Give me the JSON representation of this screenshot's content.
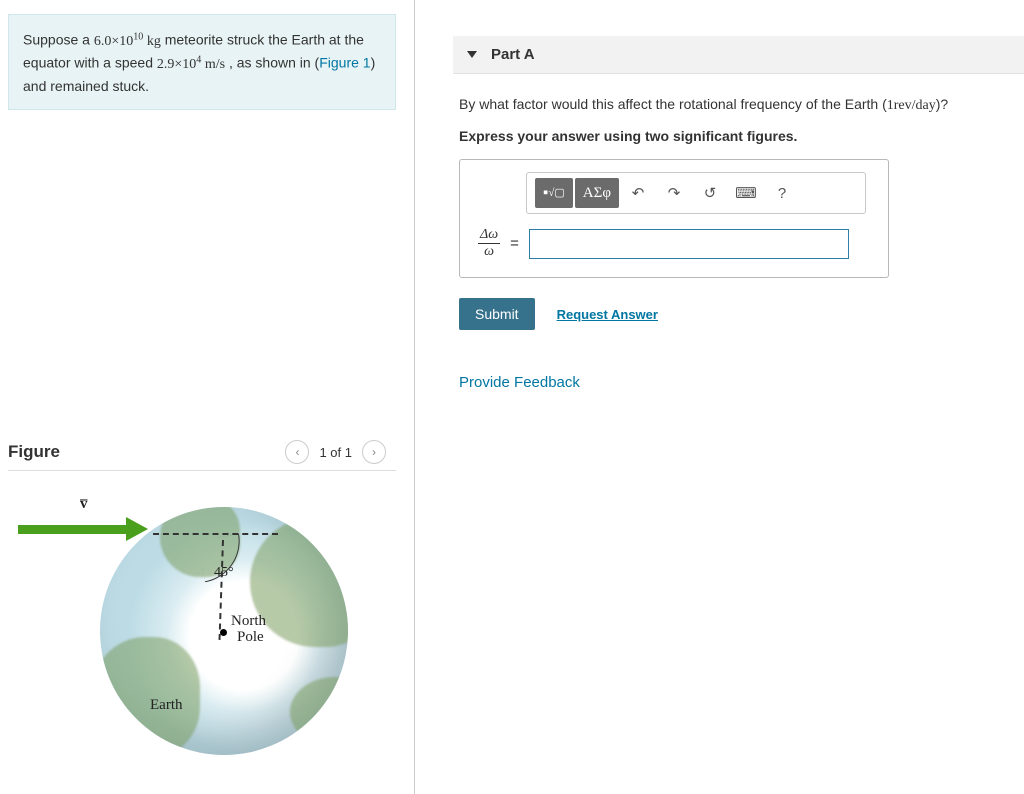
{
  "problem": {
    "before_mass": "Suppose a ",
    "mass_coeff": "6.0×10",
    "mass_exp": "10",
    "mass_unit": " kg",
    "mid1": " meteorite struck the Earth at the equator with a speed ",
    "speed_coeff": "2.9×10",
    "speed_exp": "4",
    "speed_unit": " m/s",
    "mid2": " , as shown in (",
    "figlink": "Figure 1",
    "tail": ") and remained stuck."
  },
  "figure": {
    "title": "Figure",
    "counter": "1 of 1",
    "v_label": "v̅",
    "angle": "45°",
    "north_pole_l1": "North",
    "north_pole_l2": "Pole",
    "earth_label": "Earth"
  },
  "part": {
    "label": "Part A",
    "question_pre": "By what factor would this affect the rotational frequency of the Earth (",
    "rev_expr": "1rev/day",
    "question_post": ")?",
    "instruction": "Express your answer using two significant figures."
  },
  "toolbar": {
    "template_sqrt": "√▢",
    "greek": "ΑΣφ",
    "undo": "↶",
    "redo": "↷",
    "reset": "↺",
    "keyboard": "⌨",
    "help": "?"
  },
  "answer": {
    "frac_num": "Δω",
    "frac_den": "ω",
    "equals": "=",
    "value": ""
  },
  "actions": {
    "submit": "Submit",
    "request": "Request Answer",
    "feedback": "Provide Feedback"
  }
}
